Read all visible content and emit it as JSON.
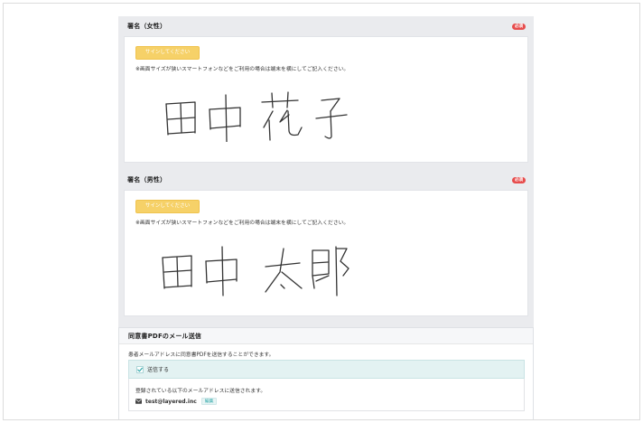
{
  "sections": {
    "female": {
      "title": "署名（女性）",
      "badge": "必須",
      "button": "サインしてください",
      "note": "※画面サイズが狭いスマートフォンなどをご利用の場合は端末を横にしてご記入ください。",
      "signature_text": "田中 花子"
    },
    "male": {
      "title": "署名（男性）",
      "badge": "必須",
      "button": "サインしてください",
      "note": "※画面サイズが狭いスマートフォンなどをご利用の場合は端末を横にしてご記入ください。",
      "signature_text": "田中 太郎"
    }
  },
  "mail": {
    "title": "同意書PDFのメール送信",
    "description": "患者メールアドレスに同意書PDFを送信することができます。",
    "send_label": "送信する",
    "send_checked": true,
    "address_description": "登録されている以下のメールアドレスに送信されます。",
    "email": "test@layered.inc",
    "edit": "編集"
  },
  "colors": {
    "accent": "#f6d168",
    "badge": "#e74c4c",
    "teal": "#2aa6a8",
    "panel_bg": "#eaebee"
  }
}
